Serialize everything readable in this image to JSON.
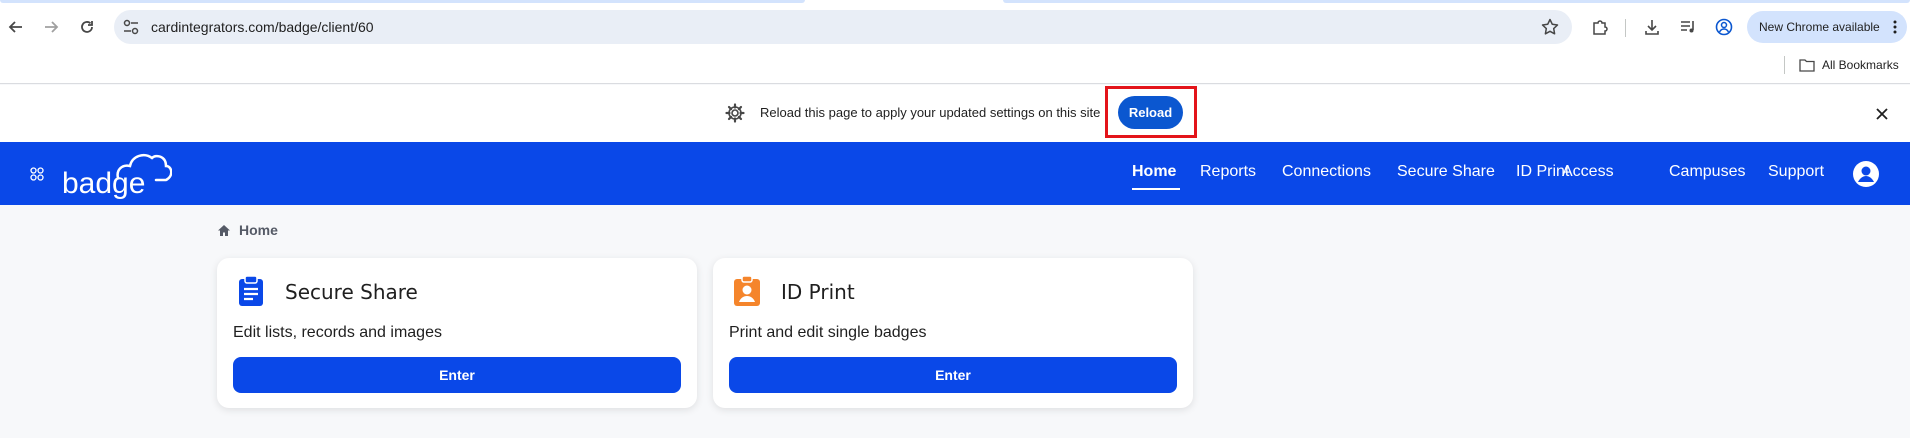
{
  "browser": {
    "url": "cardintegrators.com/badge/client/60",
    "new_chrome_label": "New Chrome available",
    "all_bookmarks_label": "All Bookmarks"
  },
  "infobar": {
    "message": "Reload this page to apply your updated settings on this site",
    "reload_label": "Reload"
  },
  "app": {
    "logo_text": "badge",
    "nav": [
      {
        "label": "Home",
        "active": true
      },
      {
        "label": "Reports"
      },
      {
        "label": "Connections"
      },
      {
        "label": "Secure Share"
      },
      {
        "label": "ID Print"
      },
      {
        "label": "Access"
      },
      {
        "label": "Campuses"
      },
      {
        "label": "Support"
      }
    ],
    "breadcrumb": "Home",
    "cards": [
      {
        "title": "Secure Share",
        "description": "Edit lists, records and images",
        "button": "Enter",
        "icon": "clipboard-icon",
        "icon_color": "#0a48e8"
      },
      {
        "title": "ID Print",
        "description": "Print and edit single badges",
        "button": "Enter",
        "icon": "id-badge-icon",
        "icon_color": "#f5852b"
      }
    ]
  },
  "colors": {
    "brand": "#0a48e8",
    "highlight": "#e3141a",
    "chrome_blue": "#0b57d0"
  }
}
